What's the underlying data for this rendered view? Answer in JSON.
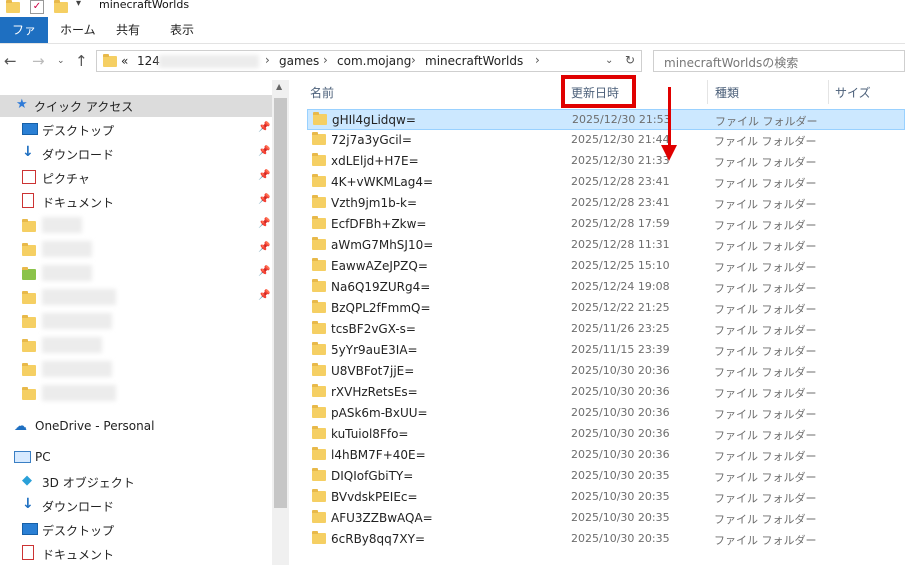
{
  "window": {
    "title": "minecraftWorlds"
  },
  "ribbon": {
    "tabs": [
      "ファイル",
      "ホーム",
      "共有",
      "表示"
    ]
  },
  "address": {
    "prefix": "«",
    "first_segment": "124",
    "segments": [
      "games",
      "com.mojang",
      "minecraftWorlds"
    ]
  },
  "search": {
    "placeholder": "minecraftWorldsの検索"
  },
  "columns": {
    "name": "名前",
    "date": "更新日時",
    "type": "種類",
    "size": "サイズ"
  },
  "nav": {
    "quick_access": "クイック アクセス",
    "quick_items": [
      "デスクトップ",
      "ダウンロード",
      "ピクチャ",
      "ドキュメント"
    ],
    "onedrive": "OneDrive - Personal",
    "pc": "PC",
    "pc_items": [
      "3D オブジェクト",
      "ダウンロード",
      "デスクトップ",
      "ドキュメント"
    ]
  },
  "files": [
    {
      "name": "gHIl4gLidqw=",
      "date": "2025/12/30 21:53",
      "type": "ファイル フォルダー"
    },
    {
      "name": "72j7a3yGcil=",
      "date": "2025/12/30 21:44",
      "type": "ファイル フォルダー"
    },
    {
      "name": "xdLEljd+H7E=",
      "date": "2025/12/30 21:33",
      "type": "ファイル フォルダー"
    },
    {
      "name": "4K+vWKMLag4=",
      "date": "2025/12/28 23:41",
      "type": "ファイル フォルダー"
    },
    {
      "name": "Vzth9jm1b-k=",
      "date": "2025/12/28 23:41",
      "type": "ファイル フォルダー"
    },
    {
      "name": "EcfDFBh+Zkw=",
      "date": "2025/12/28 17:59",
      "type": "ファイル フォルダー"
    },
    {
      "name": "aWmG7MhSJ10=",
      "date": "2025/12/28 11:31",
      "type": "ファイル フォルダー"
    },
    {
      "name": "EawwAZeJPZQ=",
      "date": "2025/12/25 15:10",
      "type": "ファイル フォルダー"
    },
    {
      "name": "Na6Q19ZURg4=",
      "date": "2025/12/24 19:08",
      "type": "ファイル フォルダー"
    },
    {
      "name": "BzQPL2fFmmQ=",
      "date": "2025/12/22 21:25",
      "type": "ファイル フォルダー"
    },
    {
      "name": "tcsBF2vGX-s=",
      "date": "2025/11/26 23:25",
      "type": "ファイル フォルダー"
    },
    {
      "name": "5yYr9auE3IA=",
      "date": "2025/11/15 23:39",
      "type": "ファイル フォルダー"
    },
    {
      "name": "U8VBFot7jjE=",
      "date": "2025/10/30 20:36",
      "type": "ファイル フォルダー"
    },
    {
      "name": "rXVHzRetsEs=",
      "date": "2025/10/30 20:36",
      "type": "ファイル フォルダー"
    },
    {
      "name": "pASk6m-BxUU=",
      "date": "2025/10/30 20:36",
      "type": "ファイル フォルダー"
    },
    {
      "name": "kuTuiol8Ffo=",
      "date": "2025/10/30 20:36",
      "type": "ファイル フォルダー"
    },
    {
      "name": "l4hBM7F+40E=",
      "date": "2025/10/30 20:36",
      "type": "ファイル フォルダー"
    },
    {
      "name": "DIQIofGbiTY=",
      "date": "2025/10/30 20:35",
      "type": "ファイル フォルダー"
    },
    {
      "name": "BVvdskPEIEc=",
      "date": "2025/10/30 20:35",
      "type": "ファイル フォルダー"
    },
    {
      "name": "AFU3ZZBwAQA=",
      "date": "2025/10/30 20:35",
      "type": "ファイル フォルダー"
    },
    {
      "name": "6cRBy8qq7XY=",
      "date": "2025/10/30 20:35",
      "type": "ファイル フォルダー"
    }
  ],
  "colors": {
    "accent": "#1e6fc1",
    "selection": "#cce8ff",
    "highlight": "#e00000"
  }
}
